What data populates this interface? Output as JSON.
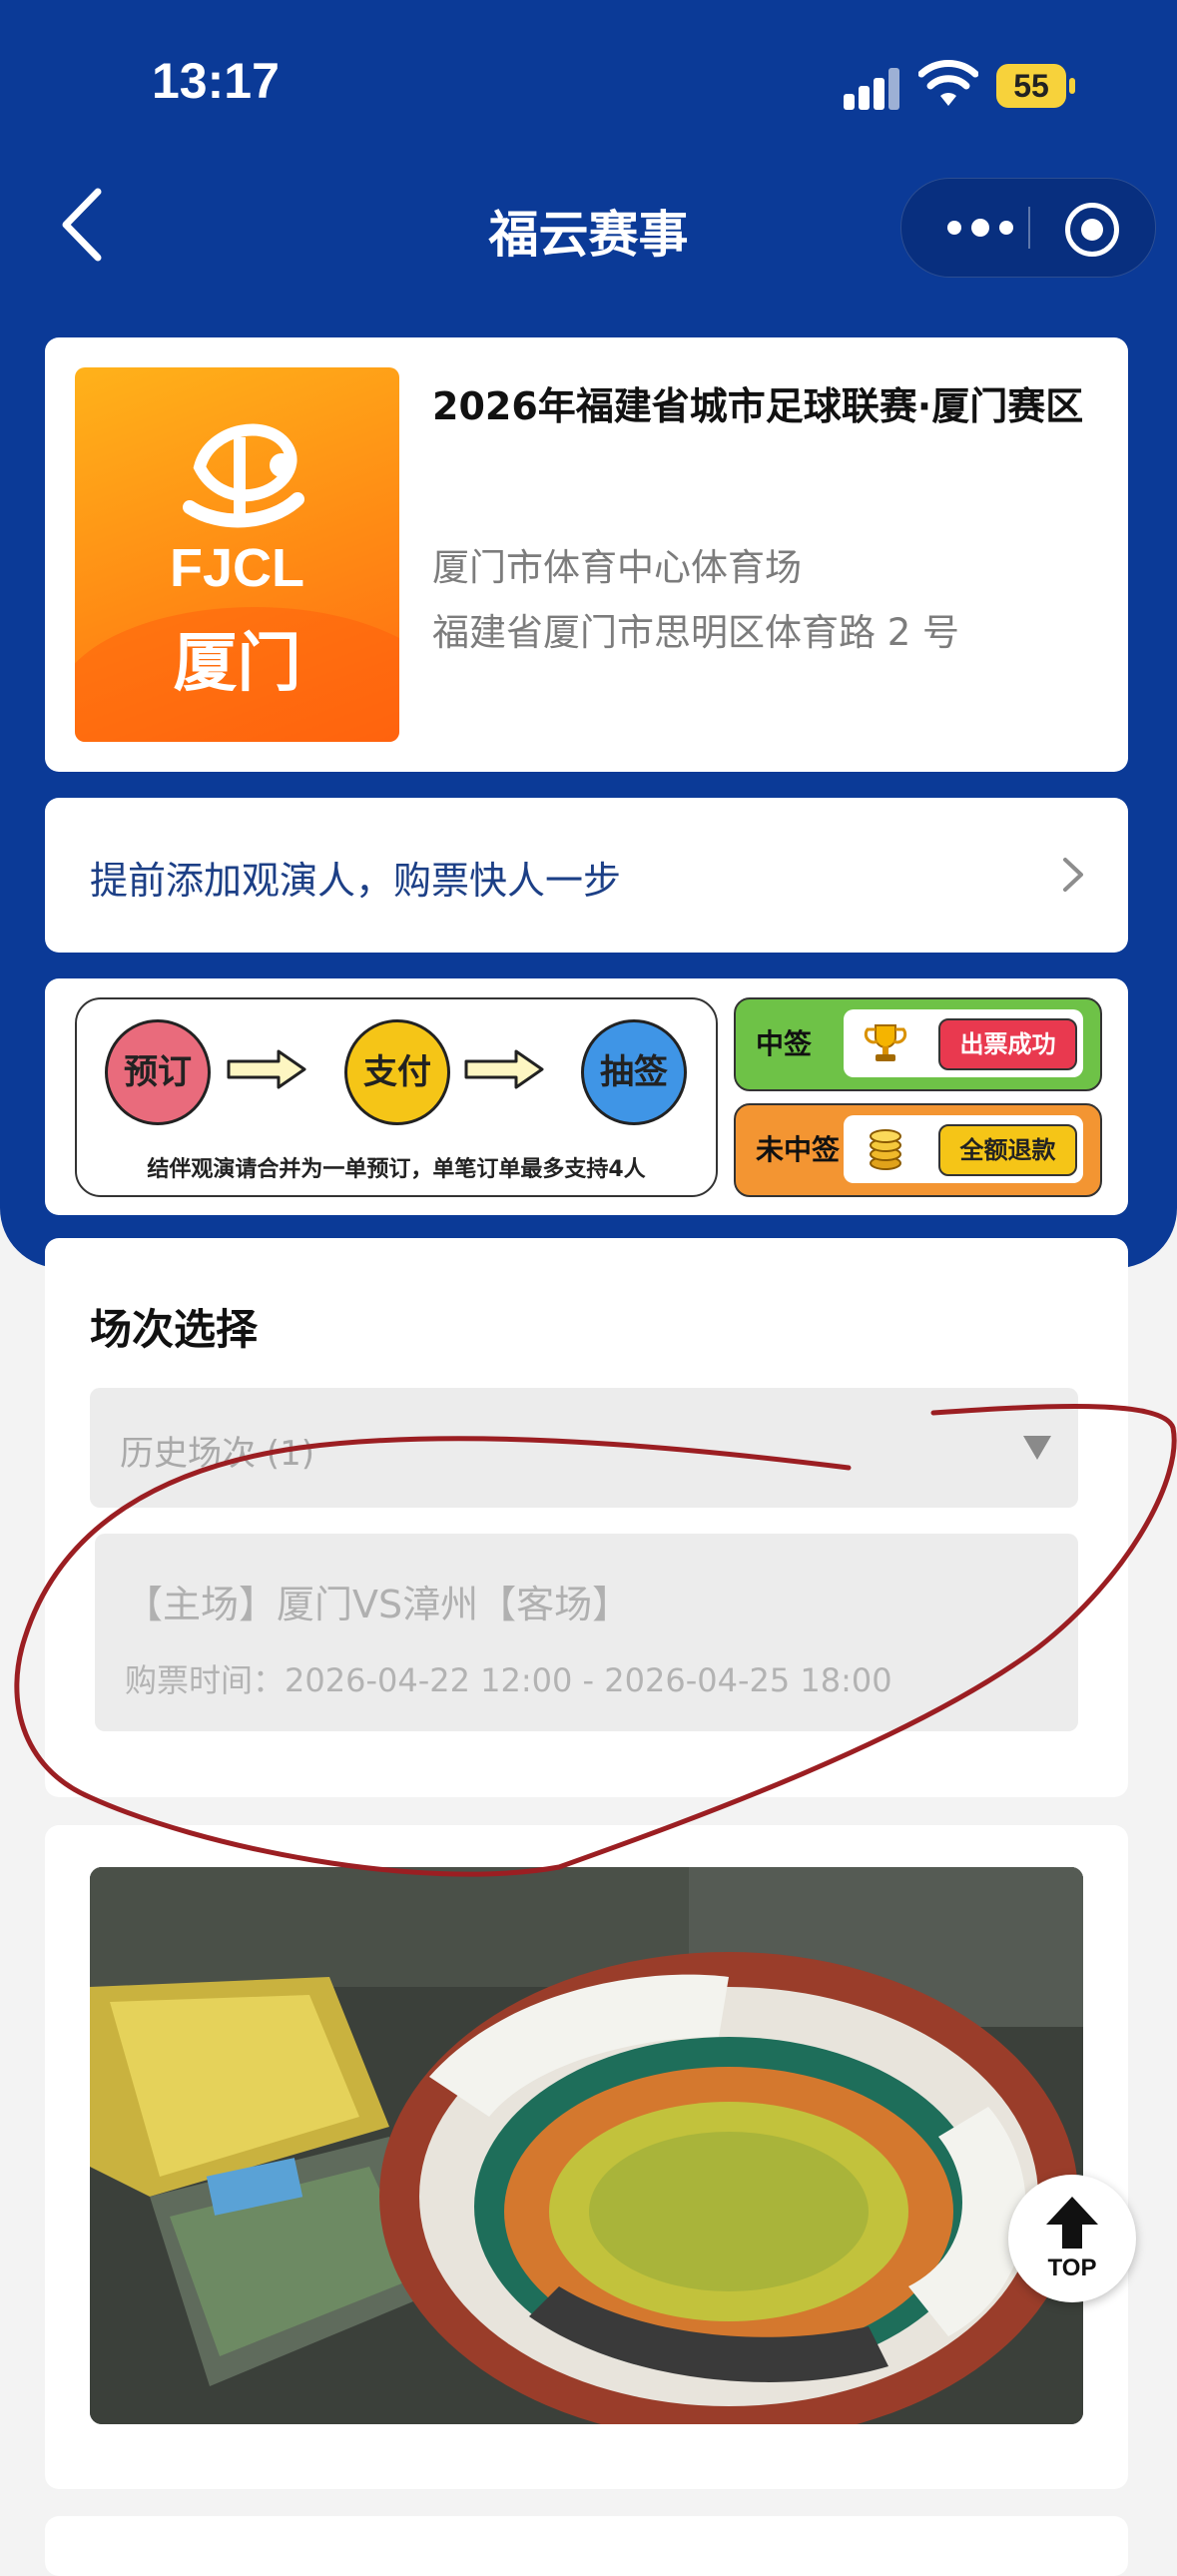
{
  "status_bar": {
    "time": "13:17",
    "battery": "55"
  },
  "nav": {
    "title": "福云赛事",
    "more_icon": "more-dots-icon",
    "close_icon": "target-icon"
  },
  "event": {
    "poster_brand": "FJCL",
    "poster_city": "厦门",
    "title": "2026年福建省城市足球联赛·厦门赛区",
    "venue": "厦门市体育中心体育场",
    "address": "福建省厦门市思明区体育路 2 号"
  },
  "add_viewer": {
    "label": "提前添加观演人，购票快人一步"
  },
  "flow": {
    "steps": [
      "预订",
      "支付",
      "抽签"
    ],
    "note": "结伴观演请合并为一单预订，单笔订单最多支持4人",
    "win_label": "中签",
    "win_result": "出票成功",
    "lose_label": "未中签",
    "lose_result": "全额退款"
  },
  "sessions": {
    "title": "场次选择",
    "history_label": "历史场次 (1)",
    "match_name": "【主场】厦门VS漳州【客场】",
    "match_time": "购票时间：2026-04-22 12:00 - 2026-04-25 18:00"
  },
  "top_button": {
    "label": "TOP"
  },
  "colors": {
    "brand_blue": "#0b3a97",
    "annotation_red": "#9b1e22"
  }
}
